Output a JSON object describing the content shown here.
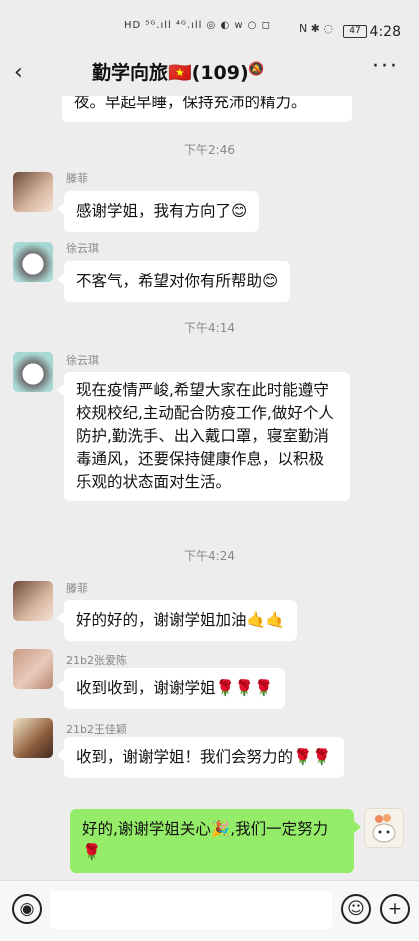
{
  "status_bar": {
    "left_icons": "HD ⁵ᴳ.ıll ⁴ᴳ.ıll ◎ ◐ w ○ ◻",
    "right_icons": "N ✱ ◌",
    "battery": "47",
    "time": "4:28"
  },
  "header": {
    "back_icon": "‹",
    "title": "勤学向旅🇻🇳(109)",
    "mute_icon": "🔕",
    "more_icon": "···"
  },
  "messages": [
    {
      "type": "bubble_partial",
      "text": "夜。早起早睡，保持充沛的精力。"
    },
    {
      "type": "time",
      "text": "下午2:46"
    },
    {
      "type": "msg",
      "sender": "滕菲",
      "text": "感谢学姐，我有方向了😊"
    },
    {
      "type": "msg",
      "sender": "徐云琪",
      "text": "不客气，希望对你有所帮助😊"
    },
    {
      "type": "time",
      "text": "下午4:14"
    },
    {
      "type": "msg",
      "sender": "徐云琪",
      "text": "现在疫情严峻,希望大家在此时能遵守校规校纪,主动配合防疫工作,做好个人防护,勤洗手、出入戴口罩，寝室勤消毒通风，还要保持健康作息，以积极乐观的状态面对生活。"
    },
    {
      "type": "time",
      "text": "下午4:24"
    },
    {
      "type": "msg",
      "sender": "滕菲",
      "text": "好的好的，谢谢学姐加油🤙🤙"
    },
    {
      "type": "msg",
      "sender": "21b2张爱陈",
      "text": "收到收到，谢谢学姐🌹🌹🌹"
    },
    {
      "type": "msg",
      "sender": "21b2王佳颖",
      "text": "收到，谢谢学姐！我们会努力的🌹🌹"
    },
    {
      "type": "mine",
      "text": "好的,谢谢学姐关心🎉,我们一定努力🌹"
    }
  ],
  "toolbar": {
    "voice_icon": "◉",
    "emoji_icon": "☺",
    "plus_icon": "+"
  }
}
